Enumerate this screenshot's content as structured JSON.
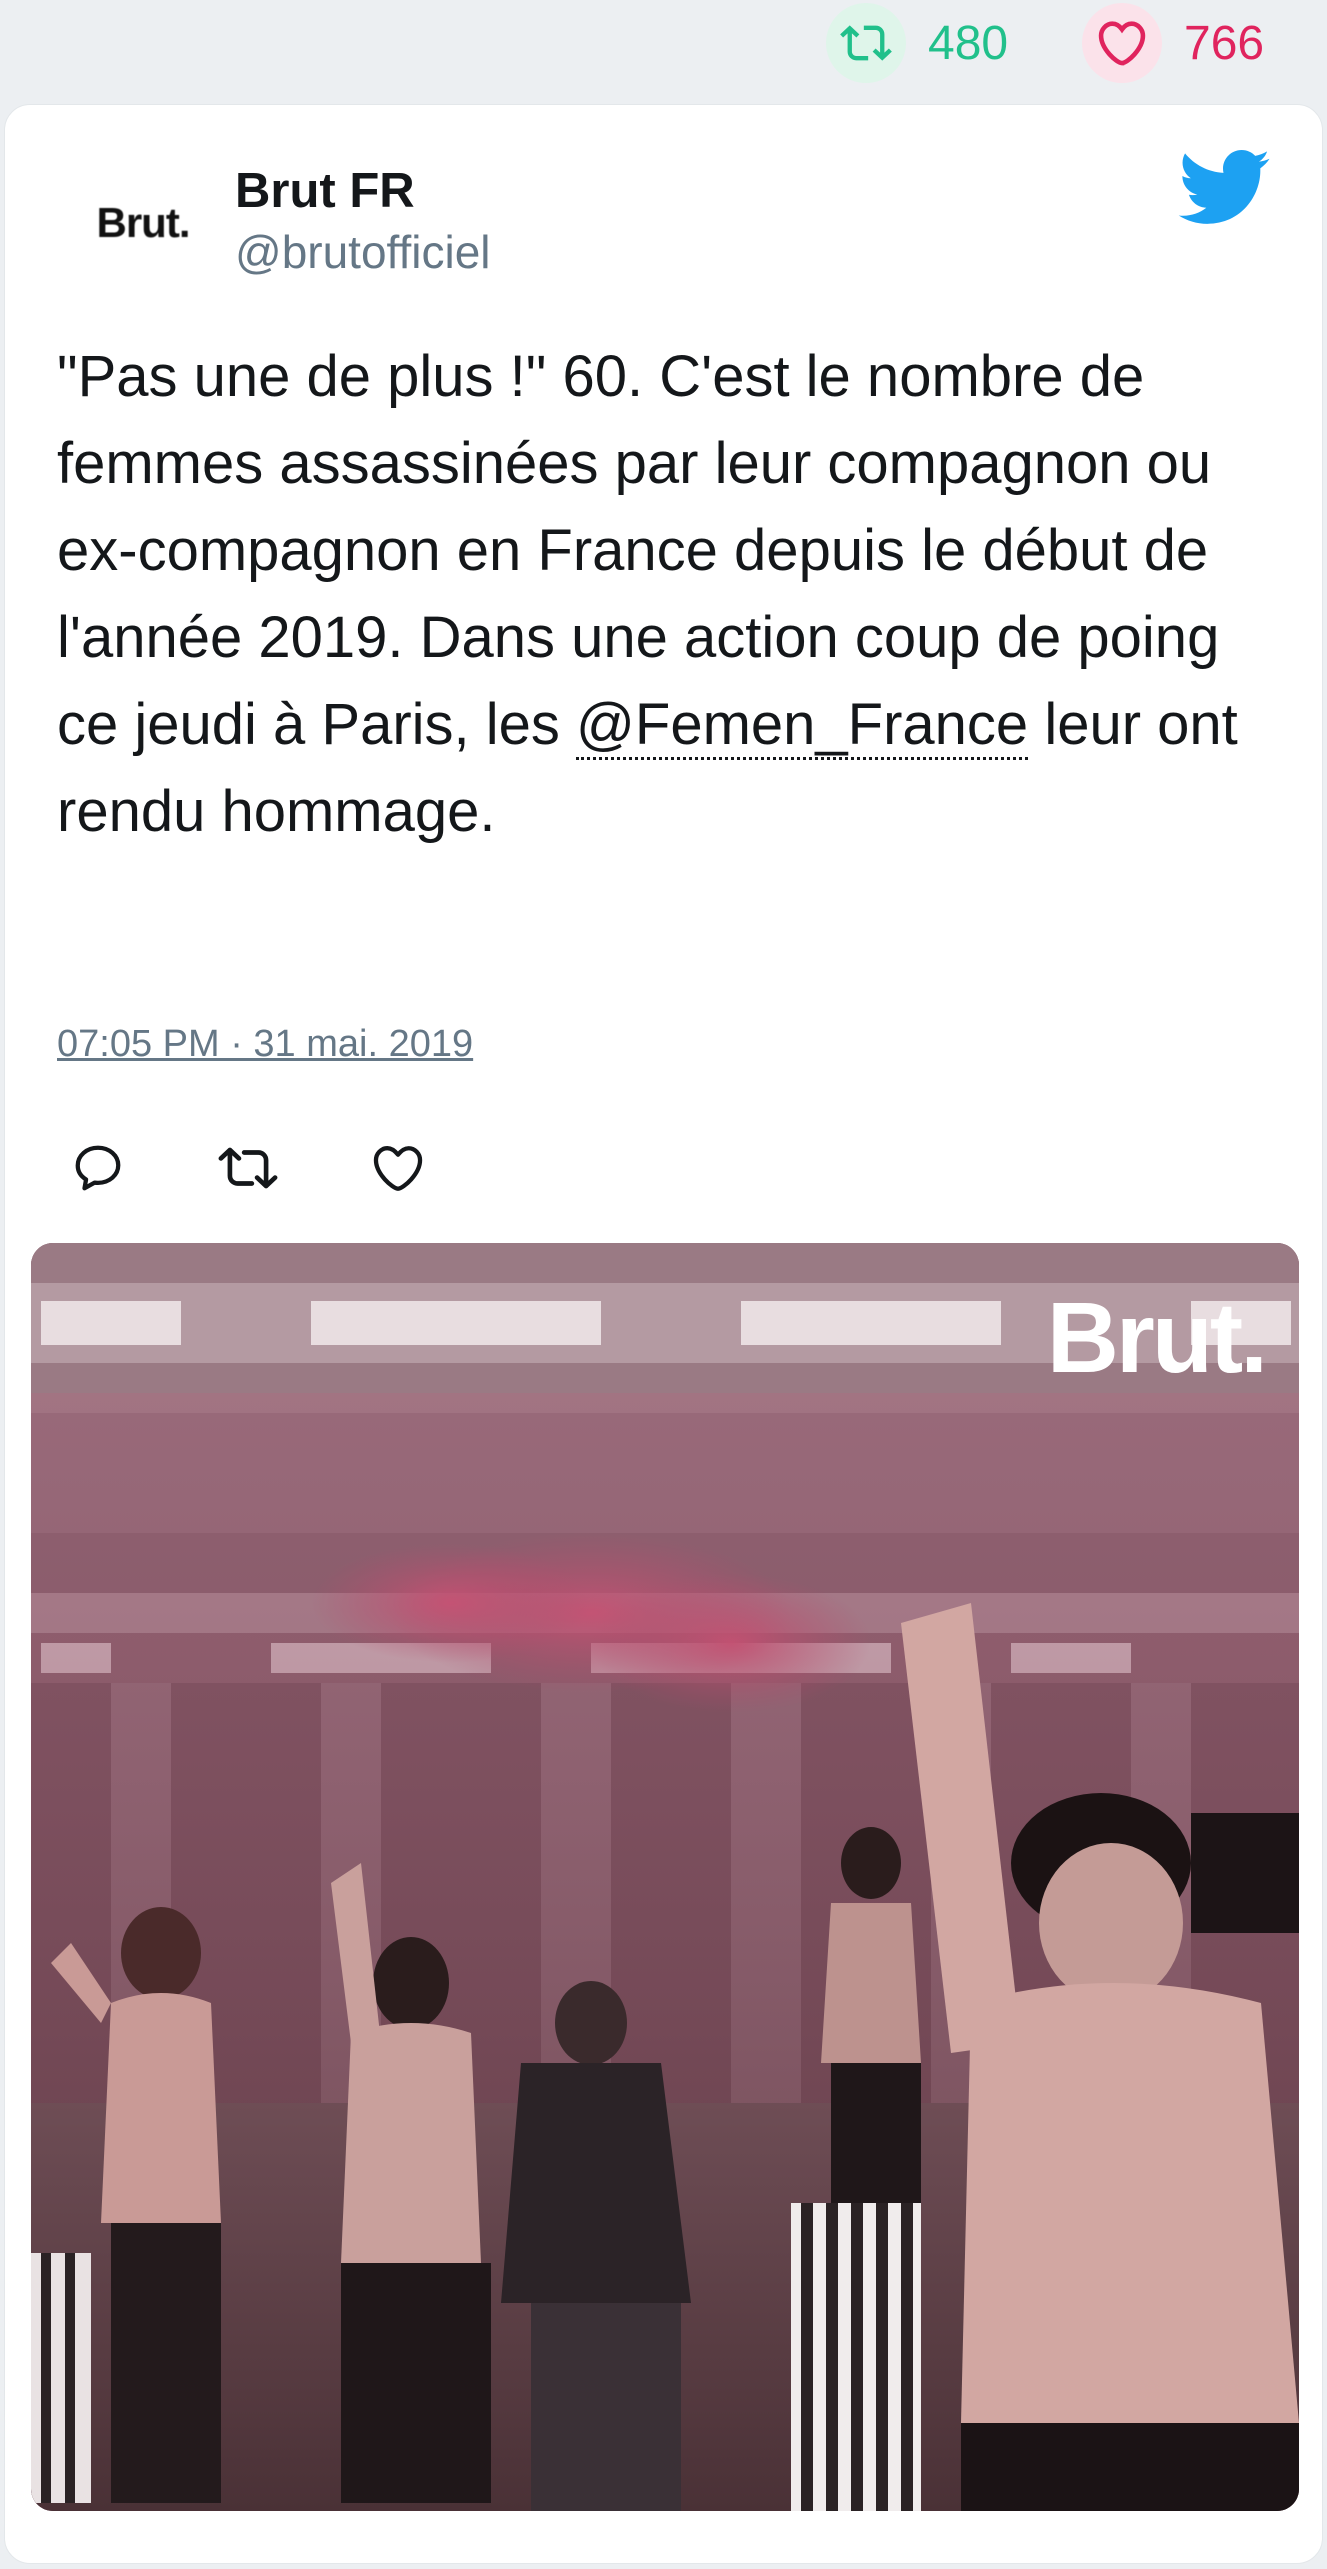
{
  "stats": {
    "retweets": "480",
    "likes": "766"
  },
  "author": {
    "avatar_text": "Brut.",
    "name": "Brut FR",
    "handle": "@brutofficiel"
  },
  "tweet": {
    "text_before": "\"Pas une de plus !\" 60. C'est le nombre de femmes assassinées par leur compagnon ou ex-compagnon en France depuis le début de l'année 2019. Dans une action coup de poing ce jeudi à Paris, les ",
    "mention": "@Femen_France",
    "text_after": " leur ont rendu hommage.",
    "timestamp": "07:05 PM · 31 mai. 2019"
  },
  "media": {
    "watermark": "Brut."
  },
  "colors": {
    "retweet_green": "#21c08b",
    "like_red": "#e0245e",
    "twitter_blue": "#1da1f2",
    "handle_gray": "#657786"
  },
  "icons": [
    "retweet-icon",
    "heart-icon",
    "twitter-bird-icon",
    "reply-icon"
  ]
}
